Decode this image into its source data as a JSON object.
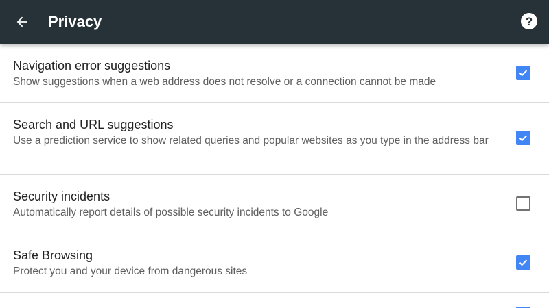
{
  "toolbar": {
    "title": "Privacy",
    "back_icon": "arrow-back-icon",
    "help_icon": "help-icon"
  },
  "colors": {
    "toolbar_bg": "#263238",
    "accent": "#4285f4"
  },
  "settings": [
    {
      "title": "Navigation error suggestions",
      "summary": "Show suggestions when a web address does not resolve or a connection cannot be made",
      "checked": true
    },
    {
      "title": "Search and URL suggestions",
      "summary": "Use a prediction service to show related queries and popular websites as you type in the address bar",
      "checked": true
    },
    {
      "title": "Security incidents",
      "summary": "Automatically report details of possible security incidents to Google",
      "checked": false
    },
    {
      "title": "Safe Browsing",
      "summary": "Protect you and your device from dangerous sites",
      "checked": true
    }
  ]
}
